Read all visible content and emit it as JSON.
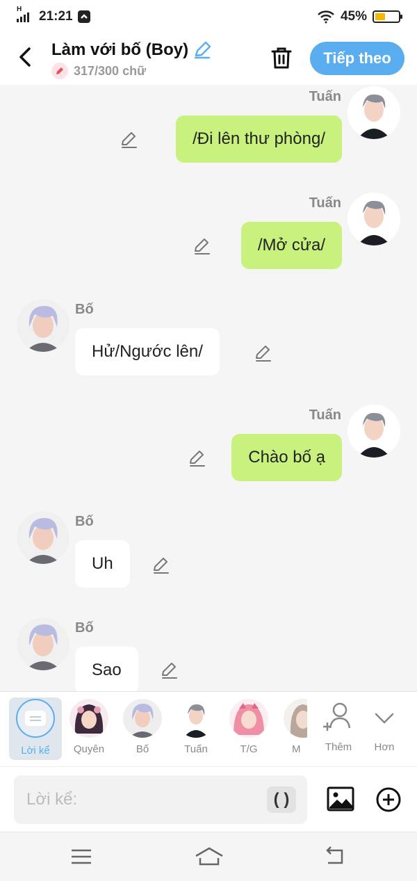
{
  "status_bar": {
    "time": "21:21",
    "network": "H",
    "battery_percent": "45%",
    "battery_level": 0.45,
    "battery_color": "#f5b700"
  },
  "header": {
    "title": "Làm với bố (Boy)",
    "word_count": "317/300 chữ",
    "next_label": "Tiếp theo",
    "accent_color": "#5aaeef"
  },
  "messages": [
    {
      "side": "right",
      "sender": "Tuấn",
      "text": "/Đi lên thư phòng/"
    },
    {
      "side": "right",
      "sender": "Tuấn",
      "text": "/Mở cửa/"
    },
    {
      "side": "left",
      "sender": "Bố",
      "text": "Hử/Ngước lên/"
    },
    {
      "side": "right",
      "sender": "Tuấn",
      "text": "Chào bố ạ"
    },
    {
      "side": "left",
      "sender": "Bố",
      "text": "Uh"
    },
    {
      "side": "left",
      "sender": "Bố",
      "text": "Sao"
    }
  ],
  "bubble_colors": {
    "me": "#c9f17e",
    "other": "#ffffff"
  },
  "characters": [
    {
      "label": "Lời kể"
    },
    {
      "label": "Quyên"
    },
    {
      "label": "Bố"
    },
    {
      "label": "Tuấn"
    },
    {
      "label": "T/G"
    },
    {
      "label": "M"
    }
  ],
  "actions": {
    "add_label": "Thêm",
    "more_label": "Hơn"
  },
  "composer": {
    "placeholder": "Lời kể:",
    "paren_label": "( )"
  }
}
